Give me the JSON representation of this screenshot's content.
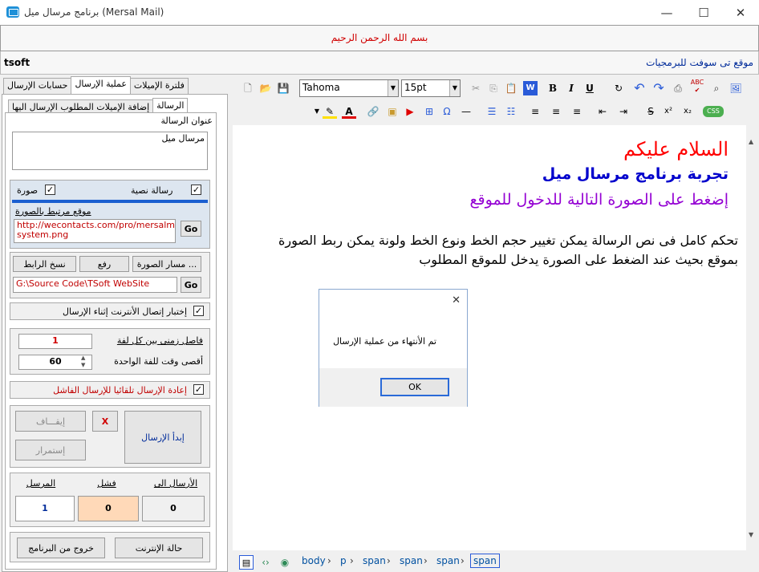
{
  "window": {
    "title": "برنامج مرسال ميل (Mersal Mail)",
    "minimize": "—",
    "maximize": "☐",
    "close": "✕"
  },
  "banner": "بسم الله الرحمن الرحيم",
  "info": {
    "left": "tsoft",
    "right": "موقع تى سوفت للبرمجيات"
  },
  "tabs_top": [
    "فلترة الإميلات",
    "عملية الإرسال",
    "حسابات الإرسال"
  ],
  "tabs_inner": [
    "الرسالة",
    "إضافة الإميلات المطلوب الإرسال اليها"
  ],
  "subject": {
    "label": "عنوان الرسالة",
    "value": "مرسال ميل"
  },
  "msgtype": {
    "text_label": "رسالة نصية",
    "image_label": "صورة",
    "link_label": "موقع مرتبط بالصورة",
    "link_value": "http://wecontacts.com/pro/mersalmail-system.png",
    "go": "Go"
  },
  "paths": {
    "image_path": "مسار الصورة ...",
    "upload": "رفع",
    "copy_link": "نسخ الرابط",
    "folder": "G:\\Source Code\\TSoft WebSite",
    "go": "Go"
  },
  "options": {
    "test_conn": "إختبار إتصال الأنترنت إثناء الإرسال",
    "interval_label": "فاصل زمنى بين كل لفة",
    "interval": "1",
    "maxtime_label": "أقصى وقت للفة الواحدة",
    "maxtime": "60",
    "resend": "إعادة الإرسال تلقائيا للإرسال الفاشل"
  },
  "controls": {
    "stop": "إيقـــاف",
    "x": "X",
    "start": "إبدأ الإرسال",
    "resume": "إستمرار"
  },
  "counts": {
    "to_label": "الأرسال الى",
    "fail_label": "فشل",
    "sent_label": "المرسل",
    "to": "0",
    "fail": "0",
    "sent": "1"
  },
  "bottom": {
    "status": "حالة الإنترنت",
    "exit": "خروج من البرنامج"
  },
  "toolbar": {
    "font": "Tahoma",
    "size": "15pt"
  },
  "editor": {
    "line1": "السلام عليكم",
    "line2": "تجربة برنامج مرسال ميل",
    "line3": "إضغط على الصورة التالية للدخول للموقع",
    "para": "تحكم كامل فى نص الرسالة يمكن تغيير حجم الخط ونوع الخط ولونة يمكن ربط الصورة بموقع بحيث عند الضغط على الصورة يدخل للموقع المطلوب"
  },
  "breadcrumbs": [
    "body",
    "p",
    "span",
    "span",
    "span",
    "span"
  ],
  "dialog": {
    "message": "تم الأنتهاء من عملية الإرسال",
    "ok": "OK",
    "close": "✕"
  },
  "colors": {
    "banner_text": "#d00000",
    "line1": "#ff0000",
    "line2": "#0000cc",
    "line3": "#9400d3"
  }
}
